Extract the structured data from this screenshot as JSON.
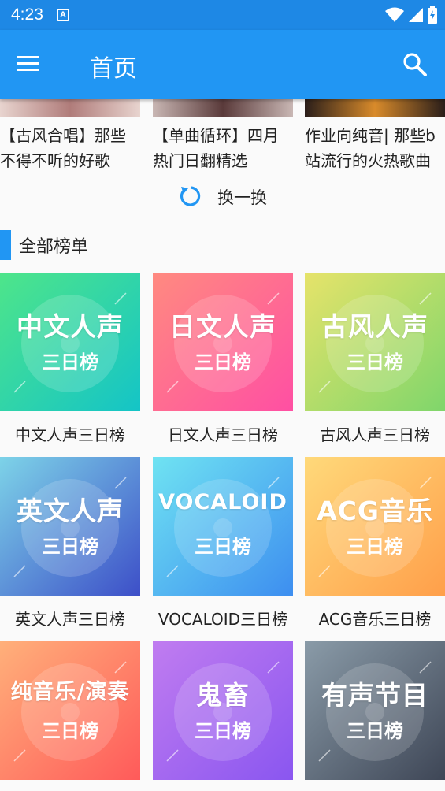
{
  "status": {
    "time": "4:23",
    "notif_letter": "A"
  },
  "appbar": {
    "title": "首页"
  },
  "recommendations": [
    {
      "line1": "【古风合唱】那些",
      "line2": "不得不听的好歌",
      "colors": [
        "#e8d4cf",
        "#b07c7a"
      ]
    },
    {
      "line1": "【单曲循环】四月",
      "line2": "热门日翻精选",
      "colors": [
        "#c9b7b4",
        "#5a3a3a"
      ]
    },
    {
      "line1": "作业向纯音| 那些b",
      "line2": "站流行的火热歌曲",
      "colors": [
        "#2a1e1a",
        "#d98b2b"
      ]
    }
  ],
  "refresh": {
    "label": "换一换"
  },
  "section": {
    "title": "全部榜单"
  },
  "charts": [
    {
      "big": "中文人声",
      "small": "三日榜",
      "caption": "中文人声三日榜",
      "c1": "#4ee58a",
      "c2": "#14c4c7"
    },
    {
      "big": "日文人声",
      "small": "三日榜",
      "caption": "日文人声三日榜",
      "c1": "#ff8a80",
      "c2": "#ff4fa3"
    },
    {
      "big": "古风人声",
      "small": "三日榜",
      "caption": "古风人声三日榜",
      "c1": "#e6e36a",
      "c2": "#7fd66b"
    },
    {
      "big": "英文人声",
      "small": "三日榜",
      "caption": "英文人声三日榜",
      "c1": "#7dd3e8",
      "c2": "#3d4fc8"
    },
    {
      "big": "VOCALOID",
      "small": "三日榜",
      "caption": "VOCALOID三日榜",
      "c1": "#6fe3f2",
      "c2": "#3d8ef0"
    },
    {
      "big": "ACG音乐",
      "small": "三日榜",
      "caption": "ACG音乐三日榜",
      "c1": "#ffd97a",
      "c2": "#ff9f4a"
    },
    {
      "big": "纯音乐/演奏",
      "small": "三日榜",
      "caption": "",
      "c1": "#ffb07a",
      "c2": "#ff5a5a"
    },
    {
      "big": "鬼畜",
      "small": "三日榜",
      "caption": "",
      "c1": "#c07cf0",
      "c2": "#8a56f0"
    },
    {
      "big": "有声节目",
      "small": "三日榜",
      "caption": "",
      "c1": "#8a9ba8",
      "c2": "#3e4656"
    }
  ]
}
